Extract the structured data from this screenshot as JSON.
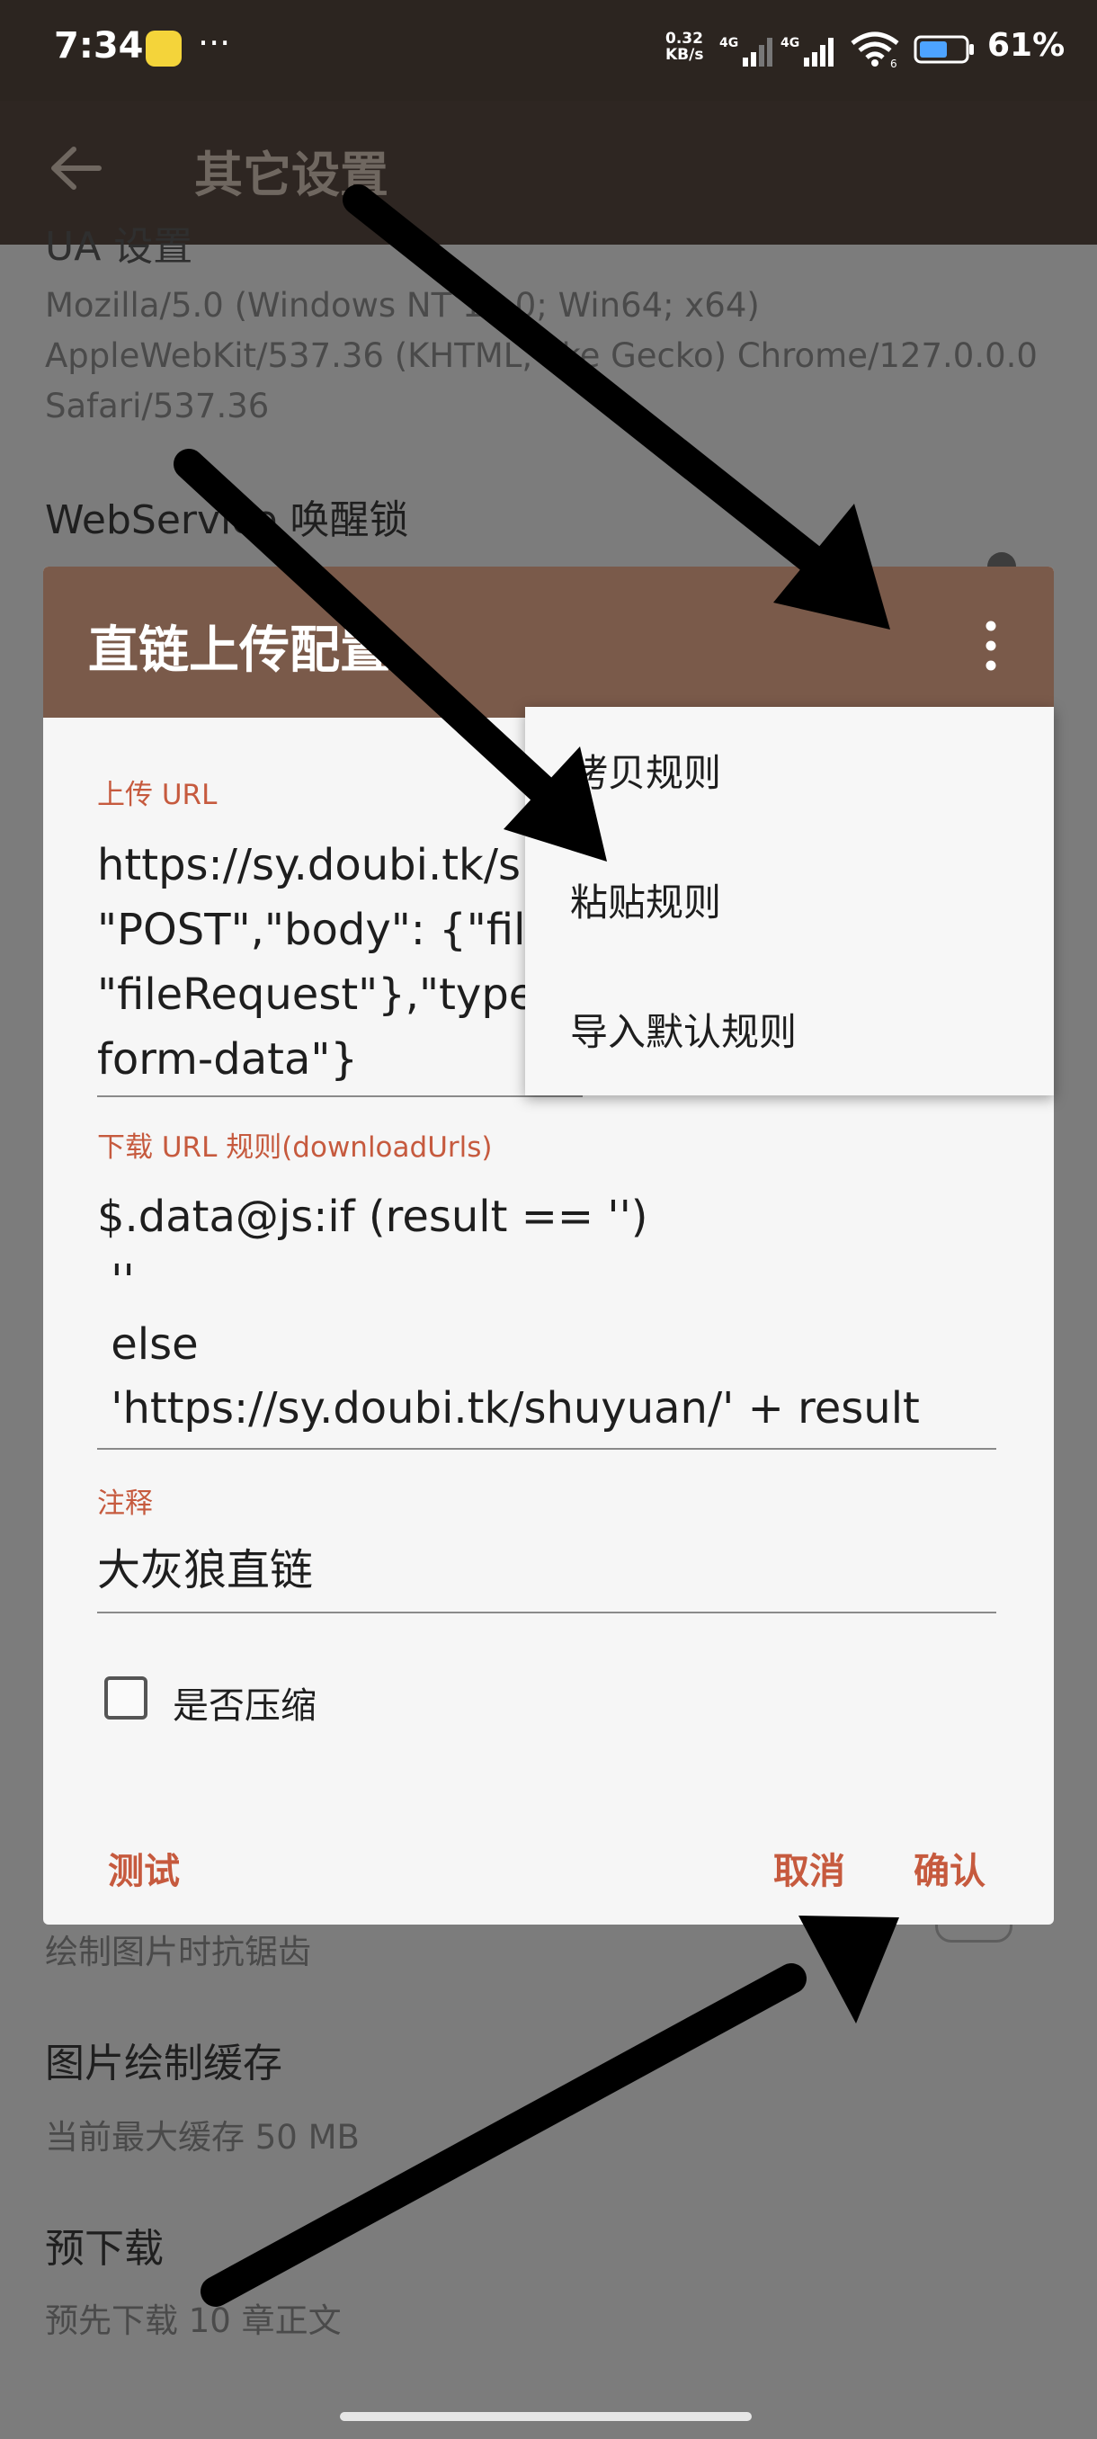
{
  "status_bar": {
    "time": "7:34",
    "net_speed_value": "0.32",
    "net_speed_unit": "KB/s",
    "signal1_label": "4G",
    "signal2_label": "4G",
    "wifi_badge": "6",
    "battery": "61%"
  },
  "toolbar": {
    "title": "其它设置"
  },
  "background": {
    "ua_heading": "UA 设置",
    "ua_value": "Mozilla/5.0 (Windows NT 10.0; Win64; x64) AppleWebKit/537.36 (KHTML, like Gecko) Chrome/127.0.0.0 Safari/537.36",
    "webservice_heading": "WebService 唤醒锁",
    "antialias_sub": "绘制图片时抗锯齿",
    "cache_heading": "图片绘制缓存",
    "cache_sub": "当前最大缓存 50 MB",
    "predownload_heading": "预下载",
    "predownload_sub": "预先下载 10 章正文"
  },
  "dialog": {
    "title": "直链上传配置",
    "upload_url_label": "上传 URL",
    "upload_url_value": "https://sy.doubi.tk/s\n\"POST\",\"body\": {\"file\n\"fileRequest\"},\"type\"\nform-data\"}",
    "download_label": "下载 URL 规则(downloadUrls)",
    "download_value": "$.data@js:if (result == '')\n ''\n else\n 'https://sy.doubi.tk/shuyuan/' + result",
    "note_label": "注释",
    "note_value": "大灰狼直链",
    "compress_label": "是否压缩",
    "compress_checked": false,
    "test_label": "测试",
    "cancel_label": "取消",
    "confirm_label": "确认"
  },
  "menu": {
    "items": [
      "拷贝规则",
      "粘贴规则",
      "导入默认规则"
    ]
  },
  "colors": {
    "dialog_header": "#7a5a4a",
    "accent": "#c65a3e",
    "status_bar": "#2c2520"
  }
}
